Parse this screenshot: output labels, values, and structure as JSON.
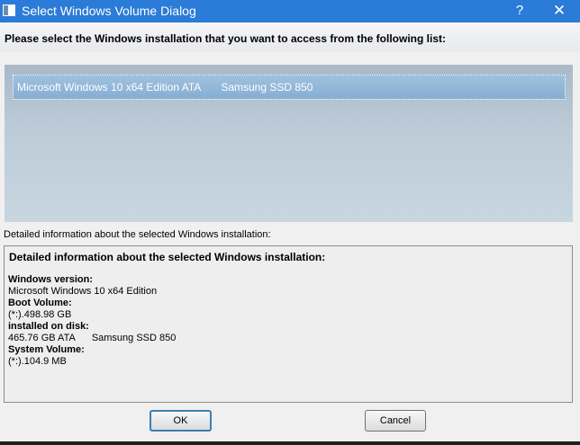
{
  "window": {
    "title": "Select Windows Volume Dialog",
    "help_glyph": "?",
    "close_glyph": "✕",
    "accent_color": "#2b7bd8"
  },
  "prompt": "Please select the Windows installation that you want to access from the following list:",
  "list": {
    "items": [
      {
        "name": "Microsoft Windows 10 x64 Edition ATA",
        "disk": "Samsung SSD 850",
        "selected": true
      }
    ]
  },
  "details": {
    "label": "Detailed information about the selected Windows installation:",
    "heading": "Detailed information about the selected Windows installation:",
    "windows_version_key": "Windows version:",
    "windows_version_value": "Microsoft Windows 10 x64 Edition",
    "boot_volume_key": "Boot Volume:",
    "boot_volume_value": "(*:).498.98 GB",
    "installed_on_disk_key": "installed on disk:",
    "installed_on_disk_size": "465.76 GB ATA",
    "installed_on_disk_model": "Samsung SSD 850",
    "system_volume_key": "System Volume:",
    "system_volume_value": "(*:).104.9 MB"
  },
  "buttons": {
    "ok": "OK",
    "cancel": "Cancel"
  }
}
